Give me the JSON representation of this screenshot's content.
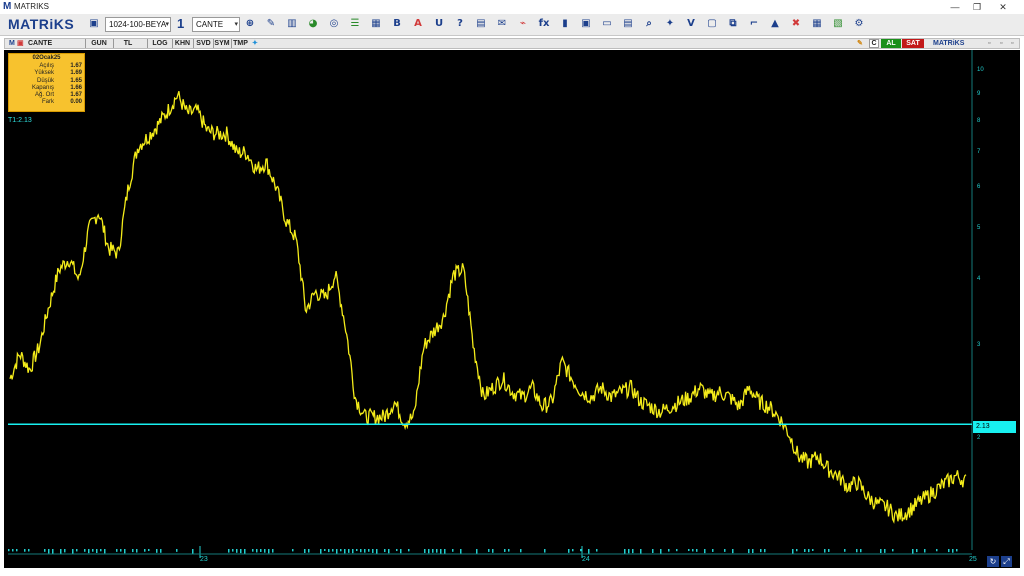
{
  "window": {
    "title": "MATRIKS",
    "logo_glyph": "M",
    "minimize": "—",
    "maximize": "❐",
    "close": "✕"
  },
  "toolbar": {
    "brand": "MATRiKS",
    "template_select": "1024-100-BEYA",
    "layout_number": "1",
    "symbol_select": "CANTE",
    "dropdown_glyph": "▾",
    "icons": [
      {
        "name": "zoom-icon",
        "glyph": "⊕",
        "color": "#1c3f8c"
      },
      {
        "name": "draw-tool-icon",
        "glyph": "✎",
        "color": "#1c3f8c"
      },
      {
        "name": "bar-chart-icon",
        "glyph": "▥",
        "color": "#1c3f8c"
      },
      {
        "name": "pie-chart-icon",
        "glyph": "◕",
        "color": "#2a8a2a"
      },
      {
        "name": "globe-icon",
        "glyph": "◎",
        "color": "#1c3f8c"
      },
      {
        "name": "list-icon",
        "glyph": "☰",
        "color": "#2a8a2a"
      },
      {
        "name": "table-icon",
        "glyph": "▦",
        "color": "#1c3f8c"
      },
      {
        "name": "bold-icon",
        "glyph": "B",
        "color": "#1c3f8c"
      },
      {
        "name": "font-color-icon",
        "glyph": "A",
        "color": "#d13a3a"
      },
      {
        "name": "underline-icon",
        "glyph": "U",
        "color": "#1c3f8c"
      },
      {
        "name": "help-icon",
        "glyph": "?",
        "color": "#1c3f8c"
      },
      {
        "name": "news-icon",
        "glyph": "▤",
        "color": "#1c3f8c"
      },
      {
        "name": "mail-icon",
        "glyph": "✉",
        "color": "#1c3f8c"
      },
      {
        "name": "analysis-icon",
        "glyph": "⌁",
        "color": "#d13a3a"
      },
      {
        "name": "formula-icon",
        "glyph": "fx",
        "color": "#1c3f8c"
      },
      {
        "name": "indicator-icon",
        "glyph": "▮",
        "color": "#1c3f8c"
      },
      {
        "name": "calendar-icon",
        "glyph": "▣",
        "color": "#1c3f8c"
      },
      {
        "name": "screen-icon",
        "glyph": "▭",
        "color": "#1c3f8c"
      },
      {
        "name": "portfolio-icon",
        "glyph": "▤",
        "color": "#1c3f8c"
      },
      {
        "name": "search-icon",
        "glyph": "⌕",
        "color": "#1c3f8c"
      },
      {
        "name": "twitter-icon",
        "glyph": "✦",
        "color": "#1c3f8c"
      },
      {
        "name": "check-icon",
        "glyph": "V",
        "color": "#1c3f8c"
      },
      {
        "name": "window-icon",
        "glyph": "▢",
        "color": "#1c3f8c"
      },
      {
        "name": "restore-icon",
        "glyph": "⧉",
        "color": "#1c3f8c"
      },
      {
        "name": "link-icon",
        "glyph": "⌐",
        "color": "#1c3f8c"
      },
      {
        "name": "alert-icon",
        "glyph": "▲",
        "color": "#1c3f8c"
      },
      {
        "name": "close-window-icon",
        "glyph": "✖",
        "color": "#d13a3a"
      },
      {
        "name": "calc-icon",
        "glyph": "▦",
        "color": "#1c3f8c"
      },
      {
        "name": "export-icon",
        "glyph": "▧",
        "color": "#2a8a2a"
      },
      {
        "name": "settings-icon",
        "glyph": "⚙",
        "color": "#1c3f8c"
      }
    ]
  },
  "chart_header": {
    "symbol": "CANTE",
    "tabs": [
      "GUN",
      "TL",
      "LOG",
      "KHN",
      "SVD",
      "SYM",
      "TMP"
    ],
    "buy_label": "AL",
    "sell_label": "SAT",
    "brand": "MATRiKS",
    "c_label": "C"
  },
  "infobox": {
    "date": "02Ocak25",
    "rows": [
      {
        "label": "Açılış",
        "value": "1.67"
      },
      {
        "label": "Yüksek",
        "value": "1.69"
      },
      {
        "label": "Düşük",
        "value": "1.65"
      },
      {
        "label": "Kapanış",
        "value": "1.66"
      },
      {
        "label": "Ağ. Ort",
        "value": "1.67"
      },
      {
        "label": "Fark",
        "value": "0.00"
      }
    ]
  },
  "colors": {
    "price_line": "#f4ec1a",
    "hline": "#18f0f0",
    "axis_text": "#22d0d0",
    "background": "#000000"
  },
  "chart_data": {
    "type": "line",
    "title": "",
    "series": [
      {
        "values": [
          2.6,
          2.9,
          2.7,
          3.0,
          3.6,
          4.2,
          4.4,
          4.0,
          5.0,
          5.4,
          4.6,
          4.5,
          6.0,
          7.2,
          7.5,
          7.9,
          8.4,
          9.0,
          8.3,
          8.4,
          7.7,
          7.6,
          7.6,
          7.0,
          7.0,
          6.5,
          6.7,
          6.0,
          5.2,
          4.8,
          3.5,
          3.8,
          3.7,
          4.1,
          3.3,
          2.4,
          2.2,
          2.2,
          2.2,
          2.35,
          2.15,
          2.2,
          3.0,
          3.2,
          3.4,
          4.1,
          4.2,
          3.0,
          2.4,
          2.5,
          2.6,
          2.45,
          2.4,
          2.5,
          2.3,
          2.35,
          2.8,
          2.6,
          2.45,
          2.4,
          2.5,
          2.4,
          2.45,
          2.5,
          2.35,
          2.3,
          2.25,
          2.3,
          2.35,
          2.4,
          2.5,
          2.4,
          2.45,
          2.4,
          2.3,
          2.5,
          2.35,
          2.3,
          2.2,
          2.05,
          1.85,
          1.8,
          1.85,
          1.75,
          1.7,
          1.62,
          1.65,
          1.55,
          1.5,
          1.48,
          1.42,
          1.45,
          1.5,
          1.55,
          1.6,
          1.65,
          1.7,
          1.66
        ]
      }
    ],
    "x_ticks": [
      "23",
      "24",
      "25"
    ],
    "y_ticks": [
      "10",
      "9",
      "8",
      "7",
      "6",
      "5",
      "4",
      "3",
      "2"
    ],
    "marker_label": "T1:2.13",
    "last_value": "2.13",
    "hline_value": 2.13,
    "ylim": [
      1.4,
      10.5
    ],
    "y_scale": "log",
    "grid": false
  }
}
